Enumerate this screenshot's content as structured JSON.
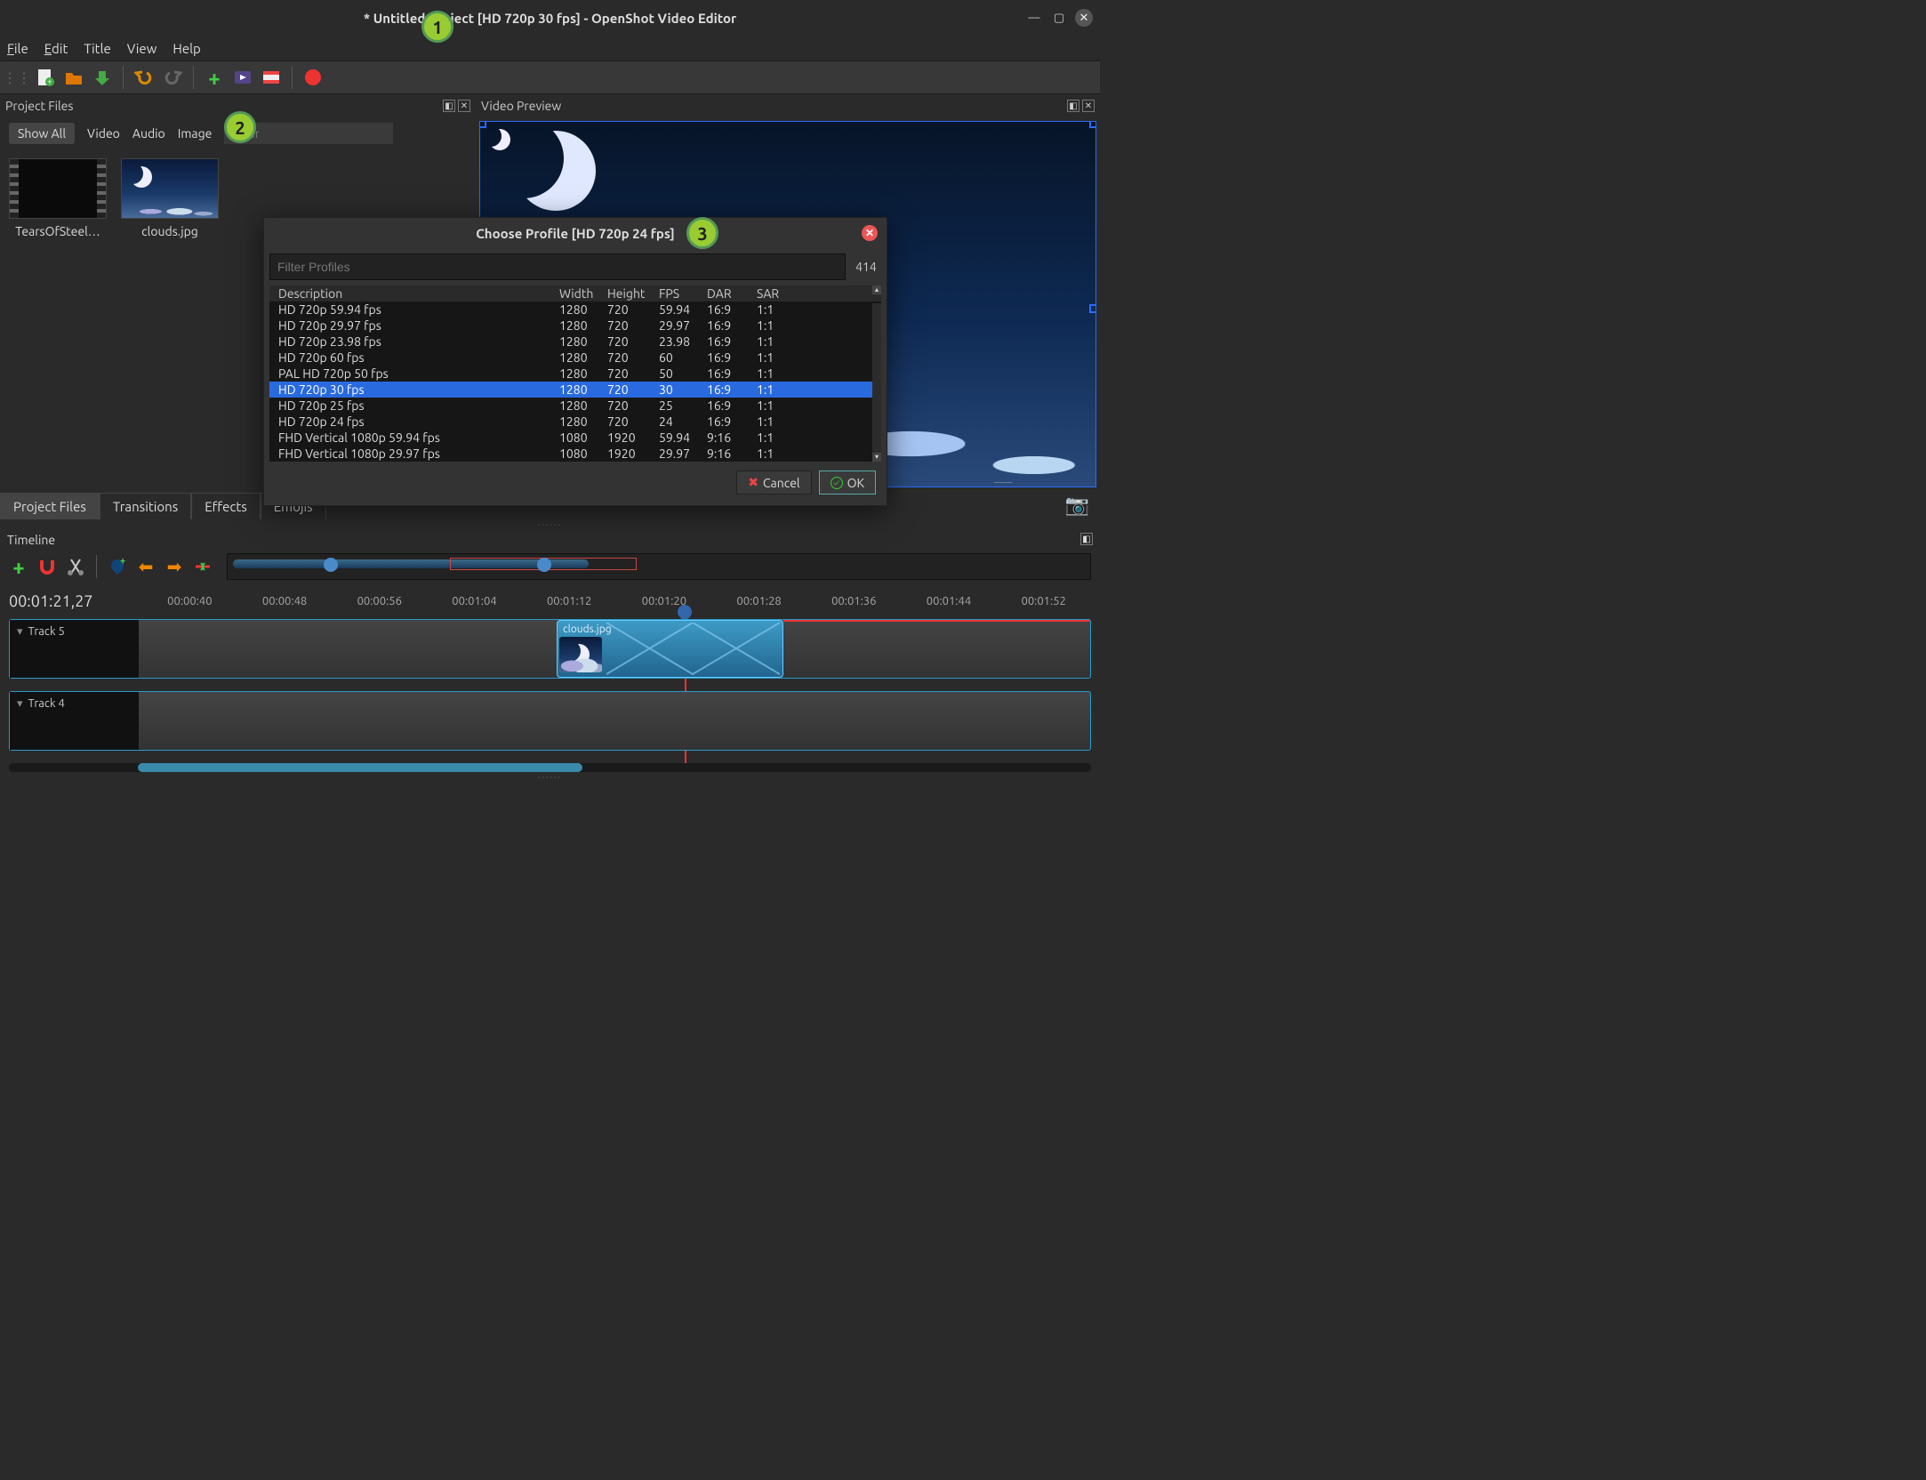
{
  "window": {
    "title": "* Untitled Project [HD 720p 30 fps] - OpenShot Video Editor"
  },
  "menus": {
    "file": "File",
    "edit": "Edit",
    "title": "Title",
    "view": "View",
    "help": "Help"
  },
  "panels": {
    "project_files": "Project Files",
    "video_preview": "Video Preview",
    "timeline": "Timeline"
  },
  "pf_filters": {
    "show_all": "Show All",
    "video": "Video",
    "audio": "Audio",
    "image": "Image",
    "placeholder": "Filter"
  },
  "files": [
    {
      "name": "TearsOfSteel…"
    },
    {
      "name": "clouds.jpg"
    }
  ],
  "tabs": {
    "project_files": "Project Files",
    "transitions": "Transitions",
    "effects": "Effects",
    "emojis": "Emojis"
  },
  "dialog": {
    "title": "Choose Profile [HD 720p 24 fps]",
    "filter_placeholder": "Filter Profiles",
    "count": "414",
    "cols": {
      "desc": "Description",
      "w": "Width",
      "h": "Height",
      "fps": "FPS",
      "dar": "DAR",
      "sar": "SAR"
    },
    "rows": [
      {
        "desc": "HD 720p 59.94 fps",
        "w": "1280",
        "h": "720",
        "fps": "59.94",
        "dar": "16:9",
        "sar": "1:1"
      },
      {
        "desc": "HD 720p 29.97 fps",
        "w": "1280",
        "h": "720",
        "fps": "29.97",
        "dar": "16:9",
        "sar": "1:1"
      },
      {
        "desc": "HD 720p 23.98 fps",
        "w": "1280",
        "h": "720",
        "fps": "23.98",
        "dar": "16:9",
        "sar": "1:1"
      },
      {
        "desc": "HD 720p 60 fps",
        "w": "1280",
        "h": "720",
        "fps": "60",
        "dar": "16:9",
        "sar": "1:1"
      },
      {
        "desc": "PAL HD 720p 50 fps",
        "w": "1280",
        "h": "720",
        "fps": "50",
        "dar": "16:9",
        "sar": "1:1"
      },
      {
        "desc": "HD 720p 30 fps",
        "w": "1280",
        "h": "720",
        "fps": "30",
        "dar": "16:9",
        "sar": "1:1",
        "selected": true
      },
      {
        "desc": "HD 720p 25 fps",
        "w": "1280",
        "h": "720",
        "fps": "25",
        "dar": "16:9",
        "sar": "1:1"
      },
      {
        "desc": "HD 720p 24 fps",
        "w": "1280",
        "h": "720",
        "fps": "24",
        "dar": "16:9",
        "sar": "1:1"
      },
      {
        "desc": "FHD Vertical 1080p 59.94 fps",
        "w": "1080",
        "h": "1920",
        "fps": "59.94",
        "dar": "9:16",
        "sar": "1:1"
      },
      {
        "desc": "FHD Vertical 1080p 29.97 fps",
        "w": "1080",
        "h": "1920",
        "fps": "29.97",
        "dar": "9:16",
        "sar": "1:1"
      }
    ],
    "cancel": "Cancel",
    "ok": "OK"
  },
  "timeline": {
    "current_time": "00:01:21,27",
    "ticks": [
      "00:00:40",
      "00:00:48",
      "00:00:56",
      "00:01:04",
      "00:01:12",
      "00:01:20",
      "00:01:28",
      "00:01:36",
      "00:01:44",
      "00:01:52"
    ],
    "tracks": [
      {
        "name": "Track 5"
      },
      {
        "name": "Track 4"
      }
    ],
    "clip_label": "clouds.jpg"
  },
  "badges": {
    "b1": "1",
    "b2": "2",
    "b3": "3"
  }
}
